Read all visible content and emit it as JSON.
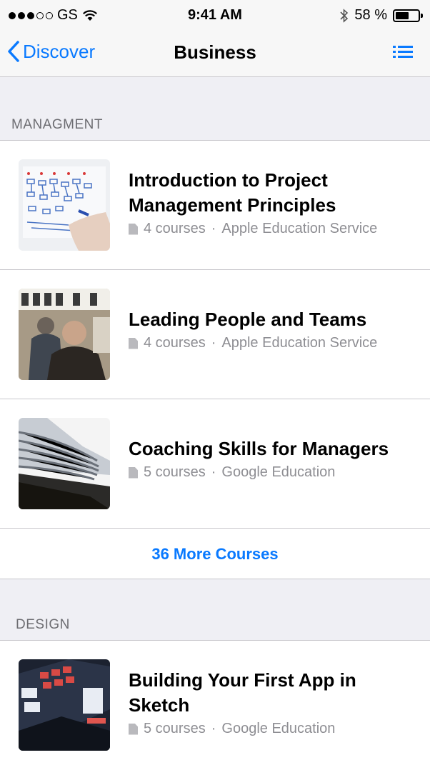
{
  "status_bar": {
    "carrier": "GS",
    "time": "9:41 AM",
    "battery": "58 %",
    "battery_level": 0.58
  },
  "nav": {
    "back_label": "Discover",
    "title": "Business",
    "list_icon": "list-icon",
    "back_icon": "chevron-left-icon"
  },
  "sections": [
    {
      "header": "MANAGMENT",
      "courses": [
        {
          "title": "Introduction to Project Management Principles",
          "count": "4 courses",
          "provider": "Apple Education Service"
        },
        {
          "title": "Leading People and Teams",
          "count": "4 courses",
          "provider": "Apple Education Service"
        },
        {
          "title": "Coaching Skills for Managers",
          "count": "5 courses",
          "provider": "Google Education"
        }
      ],
      "more_label": "36 More Courses"
    },
    {
      "header": "DESIGN",
      "courses": [
        {
          "title": "Building Your First App in Sketch",
          "count": "5 courses",
          "provider": "Google Education"
        }
      ]
    }
  ],
  "colors": {
    "accent": "#0a7aff",
    "meta": "#8e8e93",
    "section_bg": "#efeff4"
  }
}
